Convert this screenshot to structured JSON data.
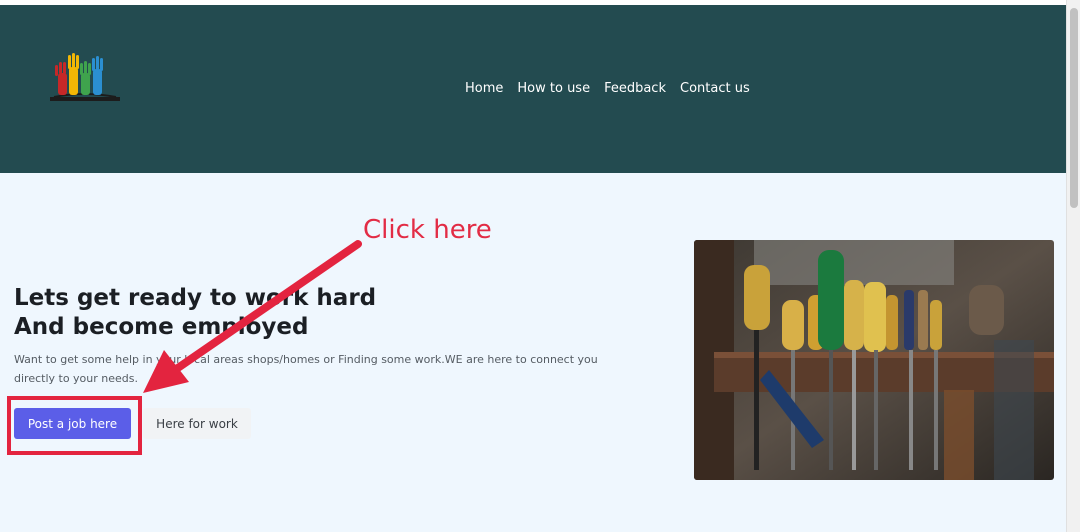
{
  "header": {
    "logo_icon": "raised-hands-logo",
    "nav": [
      {
        "label": "Home"
      },
      {
        "label": "How to use"
      },
      {
        "label": "Feedback"
      },
      {
        "label": "Contact us"
      }
    ]
  },
  "hero": {
    "title_line1": "Lets get ready to work hard",
    "title_line2": "And become employed",
    "description": "Want to get some help in your local areas shops/homes or Finding some work.WE are here to connect you directly to your needs.",
    "post_job_label": "Post a job here",
    "work_label": "Here for work",
    "image_subject": "tools-photo"
  },
  "annotation": {
    "label": "Click here",
    "color": "#e3243f"
  },
  "colors": {
    "header_bg": "#234b50",
    "main_bg": "#eff7fe",
    "primary_button": "#5b5ee8"
  }
}
